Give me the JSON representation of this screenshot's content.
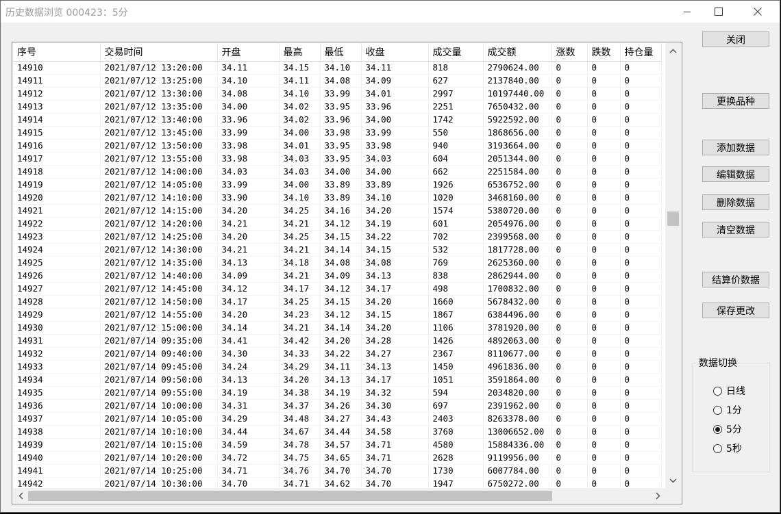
{
  "window": {
    "title": "历史数据浏览 000423：5分"
  },
  "columns": [
    "序号",
    "交易时间",
    "开盘",
    "最高",
    "最低",
    "收盘",
    "成交量",
    "成交额",
    "涨数",
    "跌数",
    "持仓量"
  ],
  "rows": [
    [
      "14910",
      "2021/07/12 13:20:00",
      "34.11",
      "34.15",
      "34.10",
      "34.11",
      "818",
      "2790624.00",
      "0",
      "0",
      "0"
    ],
    [
      "14911",
      "2021/07/12 13:25:00",
      "34.10",
      "34.11",
      "34.08",
      "34.09",
      "627",
      "2137840.00",
      "0",
      "0",
      "0"
    ],
    [
      "14912",
      "2021/07/12 13:30:00",
      "34.08",
      "34.10",
      "33.99",
      "34.01",
      "2997",
      "10197440.00",
      "0",
      "0",
      "0"
    ],
    [
      "14913",
      "2021/07/12 13:35:00",
      "34.00",
      "34.02",
      "33.95",
      "33.96",
      "2251",
      "7650432.00",
      "0",
      "0",
      "0"
    ],
    [
      "14914",
      "2021/07/12 13:40:00",
      "33.96",
      "34.02",
      "33.96",
      "34.00",
      "1742",
      "5922592.00",
      "0",
      "0",
      "0"
    ],
    [
      "14915",
      "2021/07/12 13:45:00",
      "33.99",
      "34.00",
      "33.98",
      "33.99",
      "550",
      "1868656.00",
      "0",
      "0",
      "0"
    ],
    [
      "14916",
      "2021/07/12 13:50:00",
      "33.98",
      "34.01",
      "33.95",
      "33.98",
      "940",
      "3193664.00",
      "0",
      "0",
      "0"
    ],
    [
      "14917",
      "2021/07/12 13:55:00",
      "33.98",
      "34.03",
      "33.95",
      "34.03",
      "604",
      "2051344.00",
      "0",
      "0",
      "0"
    ],
    [
      "14918",
      "2021/07/12 14:00:00",
      "34.03",
      "34.03",
      "34.00",
      "34.00",
      "662",
      "2251584.00",
      "0",
      "0",
      "0"
    ],
    [
      "14919",
      "2021/07/12 14:05:00",
      "33.99",
      "34.00",
      "33.89",
      "33.89",
      "1926",
      "6536752.00",
      "0",
      "0",
      "0"
    ],
    [
      "14920",
      "2021/07/12 14:10:00",
      "33.90",
      "34.10",
      "33.89",
      "34.10",
      "1020",
      "3468160.00",
      "0",
      "0",
      "0"
    ],
    [
      "14921",
      "2021/07/12 14:15:00",
      "34.20",
      "34.25",
      "34.16",
      "34.20",
      "1574",
      "5380720.00",
      "0",
      "0",
      "0"
    ],
    [
      "14922",
      "2021/07/12 14:20:00",
      "34.21",
      "34.21",
      "34.12",
      "34.19",
      "601",
      "2054976.00",
      "0",
      "0",
      "0"
    ],
    [
      "14923",
      "2021/07/12 14:25:00",
      "34.20",
      "34.25",
      "34.15",
      "34.22",
      "702",
      "2399568.00",
      "0",
      "0",
      "0"
    ],
    [
      "14924",
      "2021/07/12 14:30:00",
      "34.21",
      "34.21",
      "34.14",
      "34.15",
      "532",
      "1817728.00",
      "0",
      "0",
      "0"
    ],
    [
      "14925",
      "2021/07/12 14:35:00",
      "34.13",
      "34.18",
      "34.08",
      "34.08",
      "769",
      "2625360.00",
      "0",
      "0",
      "0"
    ],
    [
      "14926",
      "2021/07/12 14:40:00",
      "34.09",
      "34.21",
      "34.09",
      "34.13",
      "838",
      "2862944.00",
      "0",
      "0",
      "0"
    ],
    [
      "14927",
      "2021/07/12 14:45:00",
      "34.12",
      "34.17",
      "34.12",
      "34.17",
      "498",
      "1700832.00",
      "0",
      "0",
      "0"
    ],
    [
      "14928",
      "2021/07/12 14:50:00",
      "34.17",
      "34.25",
      "34.15",
      "34.20",
      "1660",
      "5678432.00",
      "0",
      "0",
      "0"
    ],
    [
      "14929",
      "2021/07/12 14:55:00",
      "34.20",
      "34.23",
      "34.12",
      "34.15",
      "1867",
      "6384496.00",
      "0",
      "0",
      "0"
    ],
    [
      "14930",
      "2021/07/12 15:00:00",
      "34.14",
      "34.21",
      "34.14",
      "34.20",
      "1106",
      "3781920.00",
      "0",
      "0",
      "0"
    ],
    [
      "14931",
      "2021/07/14 09:35:00",
      "34.41",
      "34.42",
      "34.20",
      "34.28",
      "1426",
      "4892063.00",
      "0",
      "0",
      "0"
    ],
    [
      "14932",
      "2021/07/14 09:40:00",
      "34.30",
      "34.33",
      "34.22",
      "34.27",
      "2367",
      "8110677.00",
      "0",
      "0",
      "0"
    ],
    [
      "14933",
      "2021/07/14 09:45:00",
      "34.24",
      "34.29",
      "34.11",
      "34.13",
      "1450",
      "4961836.00",
      "0",
      "0",
      "0"
    ],
    [
      "14934",
      "2021/07/14 09:50:00",
      "34.13",
      "34.20",
      "34.13",
      "34.17",
      "1051",
      "3591864.00",
      "0",
      "0",
      "0"
    ],
    [
      "14935",
      "2021/07/14 09:55:00",
      "34.19",
      "34.38",
      "34.19",
      "34.32",
      "594",
      "2034820.00",
      "0",
      "0",
      "0"
    ],
    [
      "14936",
      "2021/07/14 10:00:00",
      "34.31",
      "34.37",
      "34.26",
      "34.30",
      "697",
      "2391962.00",
      "0",
      "0",
      "0"
    ],
    [
      "14937",
      "2021/07/14 10:05:00",
      "34.29",
      "34.48",
      "34.27",
      "34.43",
      "2403",
      "8263378.00",
      "0",
      "0",
      "0"
    ],
    [
      "14938",
      "2021/07/14 10:10:00",
      "34.44",
      "34.67",
      "34.44",
      "34.58",
      "3760",
      "13006652.00",
      "0",
      "0",
      "0"
    ],
    [
      "14939",
      "2021/07/14 10:15:00",
      "34.59",
      "34.78",
      "34.57",
      "34.71",
      "4580",
      "15884336.00",
      "0",
      "0",
      "0"
    ],
    [
      "14940",
      "2021/07/14 10:20:00",
      "34.72",
      "34.75",
      "34.65",
      "34.71",
      "2628",
      "9119956.00",
      "0",
      "0",
      "0"
    ],
    [
      "14941",
      "2021/07/14 10:25:00",
      "34.71",
      "34.76",
      "34.70",
      "34.70",
      "1730",
      "6007784.00",
      "0",
      "0",
      "0"
    ],
    [
      "14942",
      "2021/07/14 10:30:00",
      "34.70",
      "34.71",
      "34.62",
      "34.70",
      "1947",
      "6750272.00",
      "0",
      "0",
      "0"
    ]
  ],
  "buttons": {
    "close": "关闭",
    "change_symbol": "更换品种",
    "add_data": "添加数据",
    "edit_data": "编辑数据",
    "delete_data": "删除数据",
    "clear_data": "清空数据",
    "settlement_data": "结算价数据",
    "save_changes": "保存更改"
  },
  "data_switch": {
    "title": "数据切换",
    "options": [
      "日线",
      "1分",
      "5分",
      "5秒"
    ],
    "selected": "5分"
  },
  "icons": {
    "minimize": "minimize-icon",
    "maximize": "maximize-icon",
    "close": "close-icon"
  }
}
